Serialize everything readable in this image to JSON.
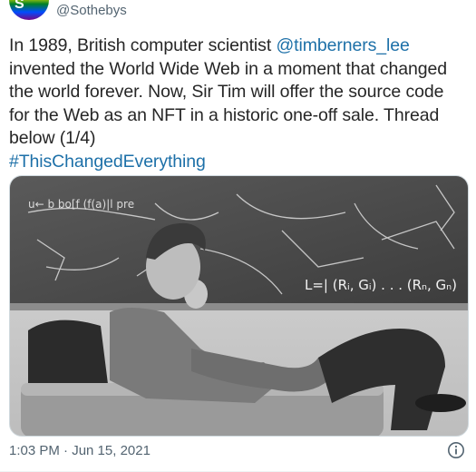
{
  "author": {
    "handle": "@Sothebys",
    "avatar_mark": "S",
    "avatar_icon": "sothebys-logo-rainbow"
  },
  "tweet": {
    "lines": [
      {
        "segments": [
          {
            "text": "In 1989, British computer scientist "
          },
          {
            "text": "@timberners_lee",
            "link": true
          }
        ]
      },
      {
        "segments": [
          {
            "text": "invented the World Wide Web in a moment that changed"
          }
        ]
      },
      {
        "segments": [
          {
            "text": "the world forever. Now, Sir Tim will offer the source code"
          }
        ]
      },
      {
        "segments": [
          {
            "text": "for the Web as an NFT in a historic one-off sale. Thread"
          }
        ]
      },
      {
        "segments": [
          {
            "text": "below (1/4)"
          }
        ]
      },
      {
        "segments": [
          {
            "text": "#ThisChangedEverything",
            "link": true
          }
        ]
      }
    ],
    "mention": "@timberners_lee",
    "hashtag": "#ThisChangedEverything",
    "link_color": "#1d70a8"
  },
  "media": {
    "type": "photo",
    "description_icon": "photo",
    "blackboard_text": {
      "formula": "L=| (Rᵢ, Gᵢ) . . . (Rₙ, Gₙ)",
      "top_left": "u← b  bo[f (f(a)|l pre"
    }
  },
  "footer": {
    "timestamp": "1:03 PM · Jun 15, 2021",
    "info_icon": "info-icon"
  }
}
